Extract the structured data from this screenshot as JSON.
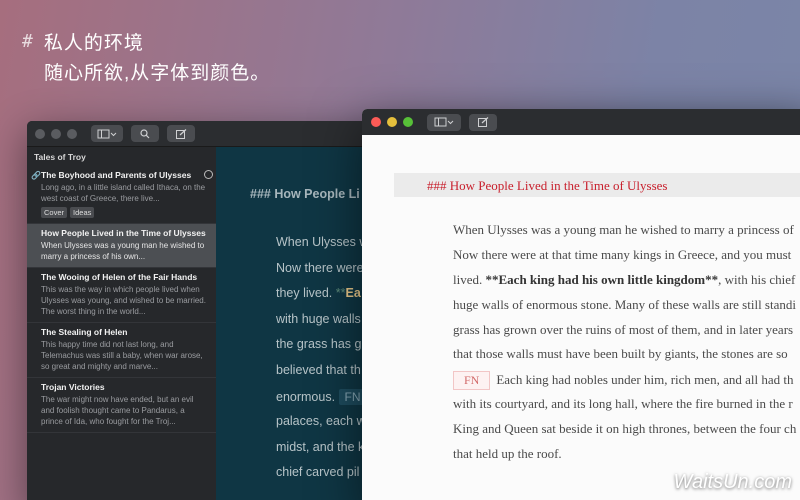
{
  "hero": {
    "hash": "#",
    "title": "私人的环境",
    "subtitle": "随心所欲,从字体到颜色。"
  },
  "back_window": {
    "sidebar": {
      "title": "Tales of Troy",
      "notes": [
        {
          "title": "The Boyhood and Parents of Ulysses",
          "preview": "Long ago, in a little island called Ithaca, on the west coast of Greece, there live...",
          "tags": [
            "Cover",
            "Ideas"
          ],
          "pinned": true
        },
        {
          "title": "How People Lived in the Time of Ulysses",
          "preview": "When Ulysses was a young man he wished to marry a princess of his own..."
        },
        {
          "title": "The Wooing of Helen of the Fair Hands",
          "preview": "This was the way in which people lived when Ulysses was young, and wished to be married. The worst thing in the world..."
        },
        {
          "title": "The Stealing of Helen",
          "preview": "This happy time did not last long, and Telemachus was still a baby, when war arose, so great and mighty and marve..."
        },
        {
          "title": "Trojan Victories",
          "preview": "The war might now have ended, but an evil and foolish thought came to Pandarus, a prince of Ida, who fought for the Troj..."
        }
      ]
    },
    "editor": {
      "heading": "### How People Li",
      "lines": [
        "When Ulysses w",
        "Now there were",
        "they lived.",
        "with huge walls",
        "the grass has g",
        "believed that th",
        "enormous.",
        "palaces, each w",
        "midst, and the k",
        "chief carved pil"
      ],
      "bold_mark": "**",
      "bold_text": "Ea",
      "fn": "FN"
    }
  },
  "front_window": {
    "heading": "### How People Lived in the Time of Ulysses",
    "lines": [
      "When Ulysses was a young man he wished to marry a princess of",
      "Now there were at that time many kings in Greece, and you must",
      "lived. ",
      "huge walls of enormous stone. Many of these walls are still standi",
      "grass has grown over the ruins of most of them, and in later years",
      "that those walls must have been built by giants, the stones are so",
      "Each king had nobles under him, rich men, and all had th",
      "with its courtyard, and its long hall, where the fire burned in the r",
      "King and Queen sat beside it on high thrones, between the four ch",
      "that held up the roof."
    ],
    "bold_phrase": "**Each king had his own little kingdom**",
    "bold_after": ", with his chief",
    "fn": "FN"
  },
  "watermark": "WaitsUn.com"
}
